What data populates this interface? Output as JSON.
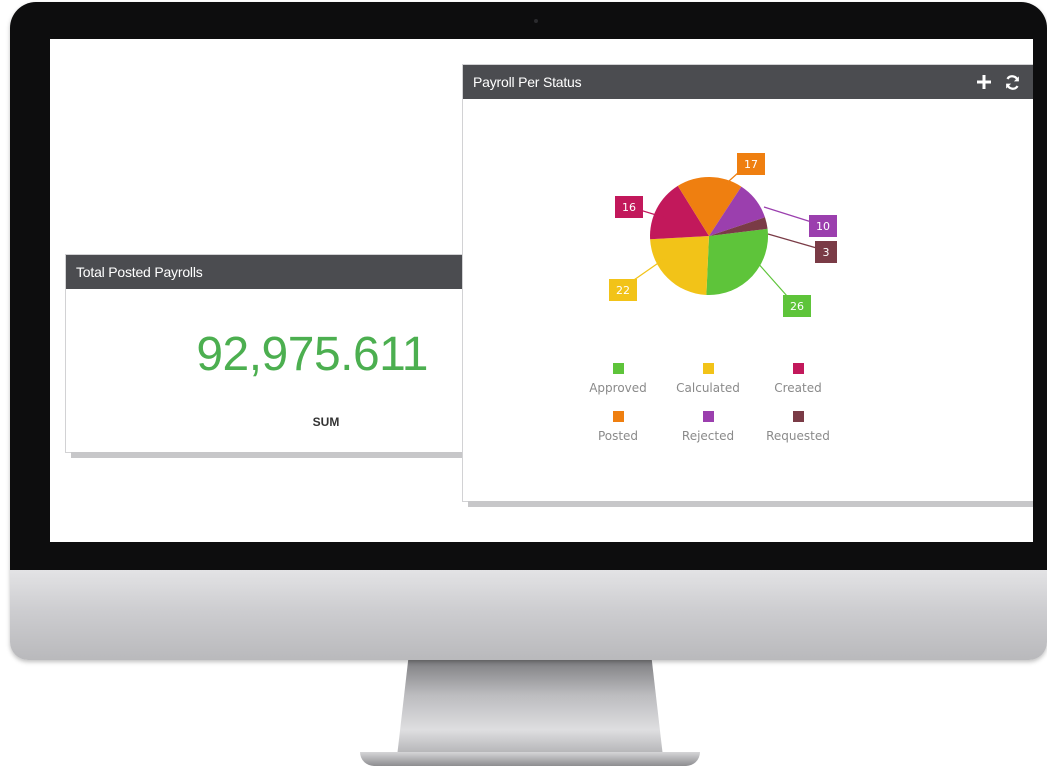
{
  "total_widget": {
    "title": "Total Posted Payrolls",
    "value": "92,975.611",
    "label": "SUM"
  },
  "pie_widget": {
    "title": "Payroll Per Status",
    "add_icon": "plus-icon",
    "refresh_icon": "refresh-icon"
  },
  "colors": {
    "header": "#4b4c50",
    "value": "#4caf50"
  },
  "chart_data": {
    "type": "pie",
    "title": "Payroll Per Status",
    "legend_position": "bottom",
    "series": [
      {
        "name": "Approved",
        "value": 26,
        "color": "#5ec43a"
      },
      {
        "name": "Calculated",
        "value": 22,
        "color": "#f2c318"
      },
      {
        "name": "Created",
        "value": 16,
        "color": "#c2185b"
      },
      {
        "name": "Posted",
        "value": 17,
        "color": "#ef7f10"
      },
      {
        "name": "Rejected",
        "value": 10,
        "color": "#9b3fae"
      },
      {
        "name": "Requested",
        "value": 3,
        "color": "#7a3b46"
      }
    ]
  }
}
